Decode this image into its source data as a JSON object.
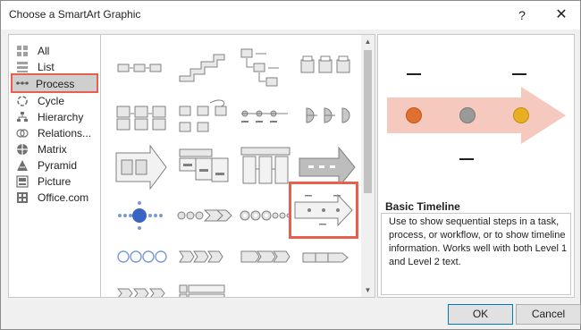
{
  "window": {
    "title": "Choose a SmartArt Graphic",
    "help_label": "?",
    "close_label": "✕"
  },
  "categories": [
    {
      "label": "All",
      "icon": "all-icon"
    },
    {
      "label": "List",
      "icon": "list-icon"
    },
    {
      "label": "Process",
      "icon": "process-icon",
      "selected": true
    },
    {
      "label": "Cycle",
      "icon": "cycle-icon"
    },
    {
      "label": "Hierarchy",
      "icon": "hierarchy-icon"
    },
    {
      "label": "Relations...",
      "icon": "relationship-icon"
    },
    {
      "label": "Matrix",
      "icon": "matrix-icon"
    },
    {
      "label": "Pyramid",
      "icon": "pyramid-icon"
    },
    {
      "label": "Picture",
      "icon": "picture-icon"
    },
    {
      "label": "Office.com",
      "icon": "office-com-icon"
    }
  ],
  "gallery": {
    "selected_layout": "Basic Timeline"
  },
  "preview": {
    "title": "Basic Timeline",
    "description": "Use to show sequential steps in a task, process, or workflow, or to show timeline information. Works well with both Level 1 and Level 2 text.",
    "colors": {
      "arrow": "#f6c9bf",
      "dot1": "#e07030",
      "dot2": "#9a9a9a",
      "dot3": "#e8b020"
    }
  },
  "buttons": {
    "ok": "OK",
    "cancel": "Cancel"
  }
}
